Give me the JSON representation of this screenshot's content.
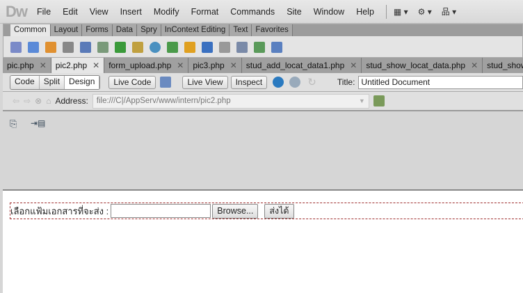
{
  "app": {
    "logo": "Dw"
  },
  "menu": [
    "File",
    "Edit",
    "View",
    "Insert",
    "Modify",
    "Format",
    "Commands",
    "Site",
    "Window",
    "Help"
  ],
  "menu_icons": [
    "layout-icon ▾",
    "gear-icon ▾",
    "site-icon ▾"
  ],
  "insert_tabs": [
    "Common",
    "Layout",
    "Forms",
    "Data",
    "Spry",
    "InContext Editing",
    "Text",
    "Favorites"
  ],
  "insert_active": "Common",
  "doc_tabs": [
    "pic.php",
    "pic2.php",
    "form_upload.php",
    "pic3.php",
    "stud_add_locat_data1.php",
    "stud_show_locat_data.php",
    "stud_show_st"
  ],
  "doc_tab_active": "pic2.php",
  "doc_toolbar": {
    "code": "Code",
    "split": "Split",
    "design": "Design",
    "live_code": "Live Code",
    "live_view": "Live View",
    "inspect": "Inspect",
    "title_label": "Title:",
    "title_value": "Untitled Document"
  },
  "address": {
    "label": "Address:",
    "value": "file:///C|/AppServ/www/intern/pic2.php"
  },
  "form": {
    "label": "เลือกแฟ้มเอกสารที่จะส่ง :",
    "browse": "Browse...",
    "submit": "ส่งได้"
  }
}
